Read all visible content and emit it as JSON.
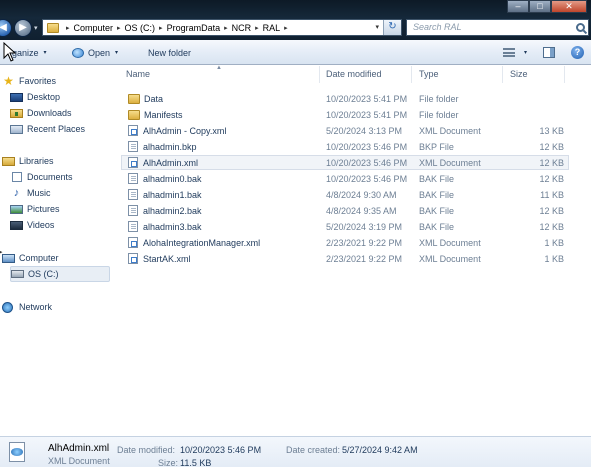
{
  "window": {
    "minimize_glyph": "–",
    "maximize_glyph": "□",
    "close_glyph": "✕"
  },
  "address": {
    "back_glyph": "◀",
    "forward_glyph": "▶",
    "breadcrumbs": [
      "Computer",
      "OS (C:)",
      "ProgramData",
      "NCR",
      "RAL"
    ],
    "separator": "▸",
    "dropdown_glyph": "▾",
    "refresh_glyph": "↻",
    "search_placeholder": "Search RAL"
  },
  "toolbar": {
    "organize_label": "ganize",
    "open_label": "Open",
    "new_folder_label": "New folder",
    "caret": "▾",
    "help_glyph": "?"
  },
  "nav": {
    "favorites": {
      "label": "Favorites",
      "icon": "star-icon"
    },
    "favorites_items": [
      {
        "label": "Desktop",
        "icon": "desktop-icon"
      },
      {
        "label": "Downloads",
        "icon": "downloads-icon"
      },
      {
        "label": "Recent Places",
        "icon": "recent-places-icon"
      }
    ],
    "libraries": {
      "label": "Libraries",
      "icon": "libraries-icon"
    },
    "libraries_items": [
      {
        "label": "Documents",
        "icon": "documents-icon"
      },
      {
        "label": "Music",
        "icon": "music-icon"
      },
      {
        "label": "Pictures",
        "icon": "pictures-icon"
      },
      {
        "label": "Videos",
        "icon": "videos-icon"
      }
    ],
    "computer": {
      "label": "Computer",
      "icon": "computer-icon"
    },
    "computer_items": [
      {
        "label": "OS (C:)",
        "icon": "drive-icon",
        "selected": true
      }
    ],
    "network": {
      "label": "Network",
      "icon": "network-icon"
    },
    "expand_glyph": "▸"
  },
  "columns": {
    "name": "Name",
    "date": "Date modified",
    "type": "Type",
    "size": "Size",
    "sort_glyph": "▲"
  },
  "files": [
    {
      "name": "Data",
      "date": "10/20/2023 5:41 PM",
      "type": "File folder",
      "size": "",
      "icon": "folder-icon"
    },
    {
      "name": "Manifests",
      "date": "10/20/2023 5:41 PM",
      "type": "File folder",
      "size": "",
      "icon": "folder-icon"
    },
    {
      "name": "AlhAdmin - Copy.xml",
      "date": "5/20/2024 3:13 PM",
      "type": "XML Document",
      "size": "13 KB",
      "icon": "xml-file-icon"
    },
    {
      "name": "alhadmin.bkp",
      "date": "10/20/2023 5:46 PM",
      "type": "BKP File",
      "size": "12 KB",
      "icon": "bak-file-icon"
    },
    {
      "name": "AlhAdmin.xml",
      "date": "10/20/2023 5:46 PM",
      "type": "XML Document",
      "size": "12 KB",
      "icon": "xml-file-icon",
      "selected": true
    },
    {
      "name": "alhadmin0.bak",
      "date": "10/20/2023 5:46 PM",
      "type": "BAK File",
      "size": "12 KB",
      "icon": "bak-file-icon"
    },
    {
      "name": "alhadmin1.bak",
      "date": "4/8/2024 9:30 AM",
      "type": "BAK File",
      "size": "11 KB",
      "icon": "bak-file-icon"
    },
    {
      "name": "alhadmin2.bak",
      "date": "4/8/2024 9:35 AM",
      "type": "BAK File",
      "size": "12 KB",
      "icon": "bak-file-icon"
    },
    {
      "name": "alhadmin3.bak",
      "date": "5/20/2024 3:19 PM",
      "type": "BAK File",
      "size": "12 KB",
      "icon": "bak-file-icon"
    },
    {
      "name": "AlohaIntegrationManager.xml",
      "date": "2/23/2021 9:22 PM",
      "type": "XML Document",
      "size": "1 KB",
      "icon": "xml-file-icon"
    },
    {
      "name": "StartAK.xml",
      "date": "2/23/2021 9:22 PM",
      "type": "XML Document",
      "size": "1 KB",
      "icon": "xml-file-icon"
    }
  ],
  "details": {
    "name": "AlhAdmin.xml",
    "type": "XML Document",
    "modified_label": "Date modified:",
    "modified_value": "10/20/2023 5:46 PM",
    "created_label": "Date created:",
    "created_value": "5/27/2024 9:42 AM",
    "size_label": "Size:",
    "size_value": "11.5 KB"
  },
  "colors": {
    "title_bg": "#102030",
    "toolbar_bg": "#e5edf7",
    "text": "#1e395b",
    "muted": "#6d7f94",
    "selection": "#f1f4f8"
  }
}
